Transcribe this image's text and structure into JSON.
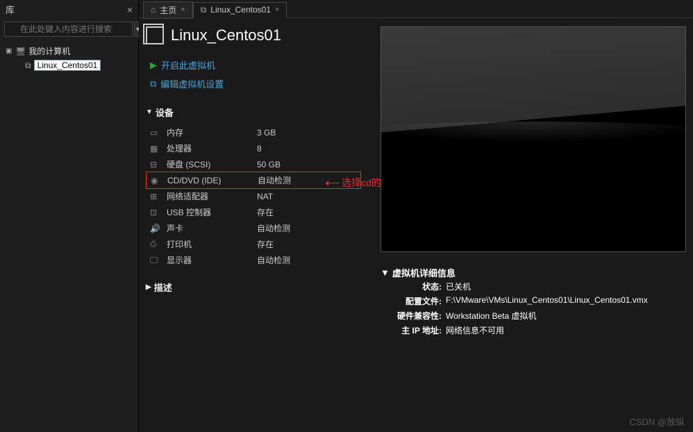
{
  "sidebar": {
    "title": "库",
    "search_placeholder": "在此处键入内容进行搜索",
    "tree": {
      "root_label": "我的计算机",
      "child_label": "Linux_Centos01"
    }
  },
  "tabs": [
    {
      "label": "主页",
      "active": false
    },
    {
      "label": "Linux_Centos01",
      "active": true
    }
  ],
  "vm": {
    "title": "Linux_Centos01",
    "actions": {
      "power_on": "开启此虚拟机",
      "edit_settings": "编辑虚拟机设置"
    }
  },
  "devices_section_title": "设备",
  "devices": [
    {
      "icon": "memory-icon",
      "label": "内存",
      "value": "3 GB"
    },
    {
      "icon": "cpu-icon",
      "label": "处理器",
      "value": "8"
    },
    {
      "icon": "disk-icon",
      "label": "硬盘 (SCSI)",
      "value": "50 GB"
    },
    {
      "icon": "cd-icon",
      "label": "CD/DVD (IDE)",
      "value": "自动检测"
    },
    {
      "icon": "network-icon",
      "label": "网络适配器",
      "value": "NAT"
    },
    {
      "icon": "usb-icon",
      "label": "USB 控制器",
      "value": "存在"
    },
    {
      "icon": "sound-icon",
      "label": "声卡",
      "value": "自动检测"
    },
    {
      "icon": "printer-icon",
      "label": "打印机",
      "value": "存在"
    },
    {
      "icon": "display-icon",
      "label": "显示器",
      "value": "自动检测"
    }
  ],
  "annotation_text": "选择cd的方式安装系统",
  "description_section_title": "描述",
  "vm_info": {
    "title": "虚拟机详细信息",
    "rows": [
      {
        "label": "状态:",
        "value": "已关机"
      },
      {
        "label": "配置文件:",
        "value": "F:\\VMware\\VMs\\Linux_Centos01\\Linux_Centos01.vmx"
      },
      {
        "label": "硬件兼容性:",
        "value": "Workstation Beta 虚拟机"
      },
      {
        "label": "主 IP 地址:",
        "value": "网络信息不可用"
      }
    ]
  },
  "watermark": "CSDN @放纵"
}
